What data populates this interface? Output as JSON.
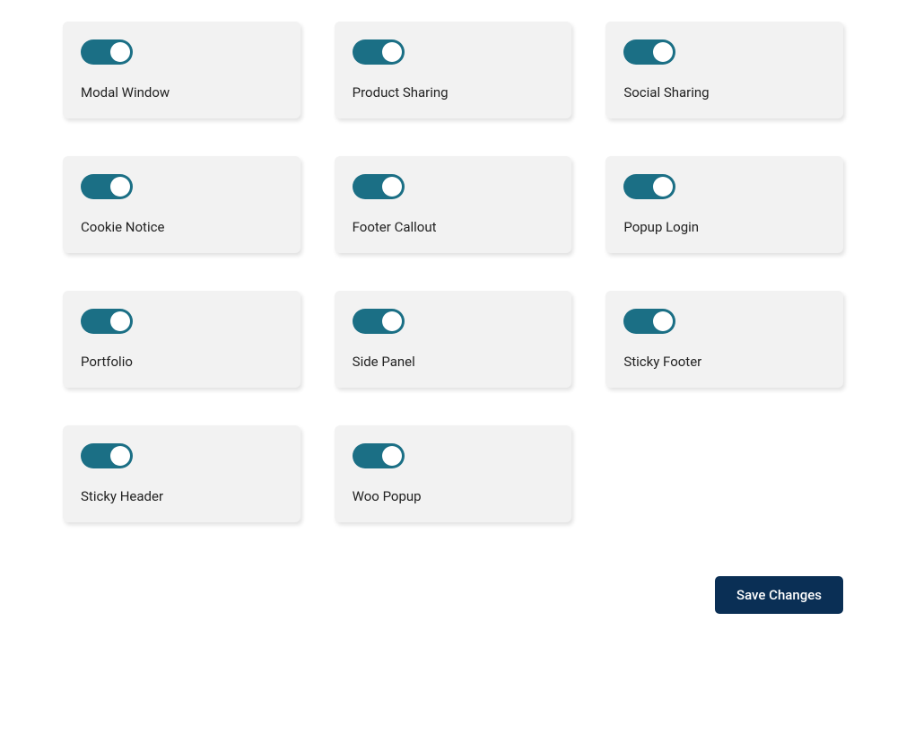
{
  "settings": [
    {
      "id": "modal-window",
      "label": "Modal Window",
      "enabled": true
    },
    {
      "id": "product-sharing",
      "label": "Product Sharing",
      "enabled": true
    },
    {
      "id": "social-sharing",
      "label": "Social Sharing",
      "enabled": true
    },
    {
      "id": "cookie-notice",
      "label": "Cookie Notice",
      "enabled": true
    },
    {
      "id": "footer-callout",
      "label": "Footer Callout",
      "enabled": true
    },
    {
      "id": "popup-login",
      "label": "Popup Login",
      "enabled": true
    },
    {
      "id": "portfolio",
      "label": "Portfolio",
      "enabled": true
    },
    {
      "id": "side-panel",
      "label": "Side Panel",
      "enabled": true
    },
    {
      "id": "sticky-footer",
      "label": "Sticky Footer",
      "enabled": true
    },
    {
      "id": "sticky-header",
      "label": "Sticky Header",
      "enabled": true
    },
    {
      "id": "woo-popup",
      "label": "Woo Popup",
      "enabled": true
    }
  ],
  "actions": {
    "save_label": "Save Changes"
  },
  "colors": {
    "toggle_on": "#1b6f85",
    "button_bg": "#0a2f55",
    "card_bg": "#f2f2f2"
  }
}
